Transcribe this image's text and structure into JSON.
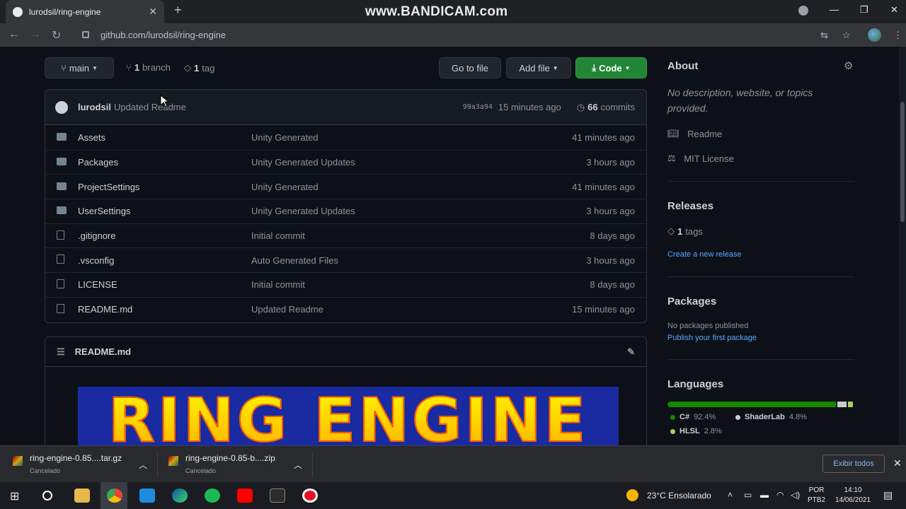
{
  "browser": {
    "tab_title": "lurodsil/ring-engine",
    "url": "github.com/lurodsil/ring-engine",
    "overlay": "www.BANDICAM.com"
  },
  "repo": {
    "branch": "main",
    "branches": "1",
    "branches_label": "branch",
    "tags": "1",
    "tags_label": "tag",
    "buttons": {
      "goto": "Go to file",
      "add": "Add file",
      "code": "Code"
    },
    "commit": {
      "author": "lurodsil",
      "message": "Updated Readme",
      "hash": "99a3a94",
      "time": "15 minutes ago",
      "count": "66",
      "count_label": "commits"
    },
    "files": [
      {
        "name": "Assets",
        "type": "dir",
        "message": "Unity Generated",
        "time": "41 minutes ago"
      },
      {
        "name": "Packages",
        "type": "dir",
        "message": "Unity Generated Updates",
        "time": "3 hours ago"
      },
      {
        "name": "ProjectSettings",
        "type": "dir",
        "message": "Unity Generated",
        "time": "41 minutes ago"
      },
      {
        "name": "UserSettings",
        "type": "dir",
        "message": "Unity Generated Updates",
        "time": "3 hours ago"
      },
      {
        "name": ".gitignore",
        "type": "file",
        "message": "Initial commit",
        "time": "8 days ago"
      },
      {
        "name": ".vsconfig",
        "type": "file",
        "message": "Auto Generated Files",
        "time": "3 hours ago"
      },
      {
        "name": "LICENSE",
        "type": "file",
        "message": "Initial commit",
        "time": "8 days ago"
      },
      {
        "name": "README.md",
        "type": "file",
        "message": "Updated Readme",
        "time": "15 minutes ago"
      }
    ],
    "readme_title": "README.md",
    "banner_text": "RING ENGINE"
  },
  "sidebar": {
    "about": "About",
    "about_text": "No description, website, or topics provided.",
    "readme": "Readme",
    "license": "MIT License",
    "releases": "Releases",
    "tags_count": "1",
    "tags_label": "tags",
    "create_release": "Create a new release",
    "packages": "Packages",
    "packages_none": "No packages published",
    "publish": "Publish your first package",
    "languages": "Languages",
    "langs": [
      {
        "name": "C#",
        "percent": "92.4%",
        "value": 92.4,
        "color": "#178600"
      },
      {
        "name": "ShaderLab",
        "percent": "4.8%",
        "value": 4.8,
        "color": "#cccccc"
      },
      {
        "name": "HLSL",
        "percent": "2.8%",
        "value": 2.8,
        "color": "#aace60"
      }
    ]
  },
  "downloads": {
    "items": [
      {
        "name": "ring-engine-0.85....tar.gz",
        "status": "Cancelado"
      },
      {
        "name": "ring-engine-0.85-b....zip",
        "status": "Cancelado"
      }
    ],
    "show_all": "Exibir todos"
  },
  "taskbar": {
    "weather": "23°C  Ensolarado",
    "lang": "POR",
    "layout": "PTB2",
    "time": "14:10",
    "date": "14/06/2021"
  }
}
